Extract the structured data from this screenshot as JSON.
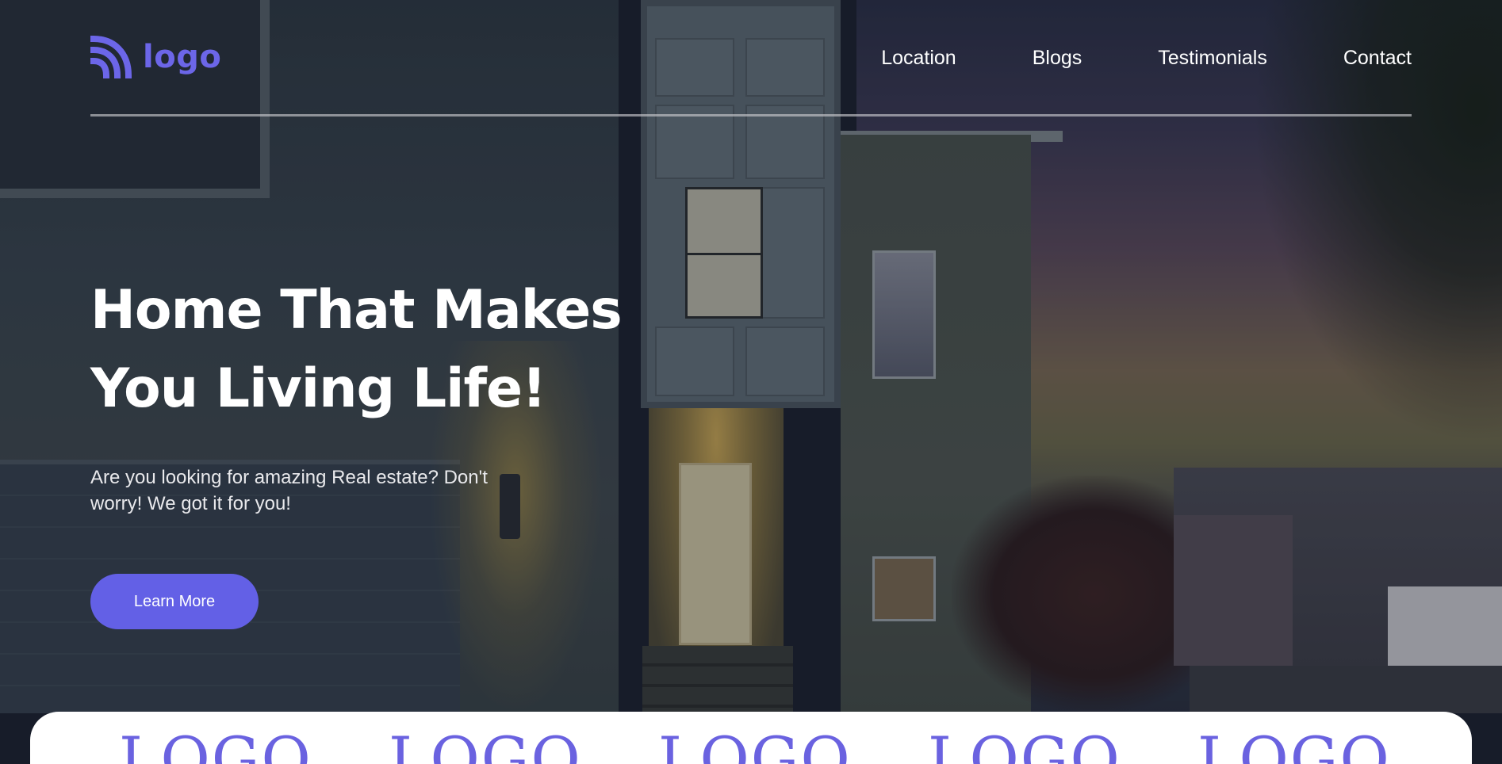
{
  "brand": {
    "name": "logo",
    "icon": "rss-arcs-icon",
    "color": "#6c66e8"
  },
  "nav": {
    "items": [
      {
        "label": "Location"
      },
      {
        "label": "Blogs"
      },
      {
        "label": "Testimonials"
      },
      {
        "label": "Contact"
      }
    ]
  },
  "hero": {
    "title_line1": "Home That Makes",
    "title_line2": "You Living Life!",
    "subtitle": "Are you looking for amazing Real estate? Don't worry! We got it for you!",
    "cta_label": "Learn More",
    "cta_color": "#6360e6"
  },
  "partners": {
    "logos": [
      "LOGO",
      "LOGO",
      "LOGO",
      "LOGO",
      "LOGO"
    ],
    "color": "#6a62e0"
  }
}
